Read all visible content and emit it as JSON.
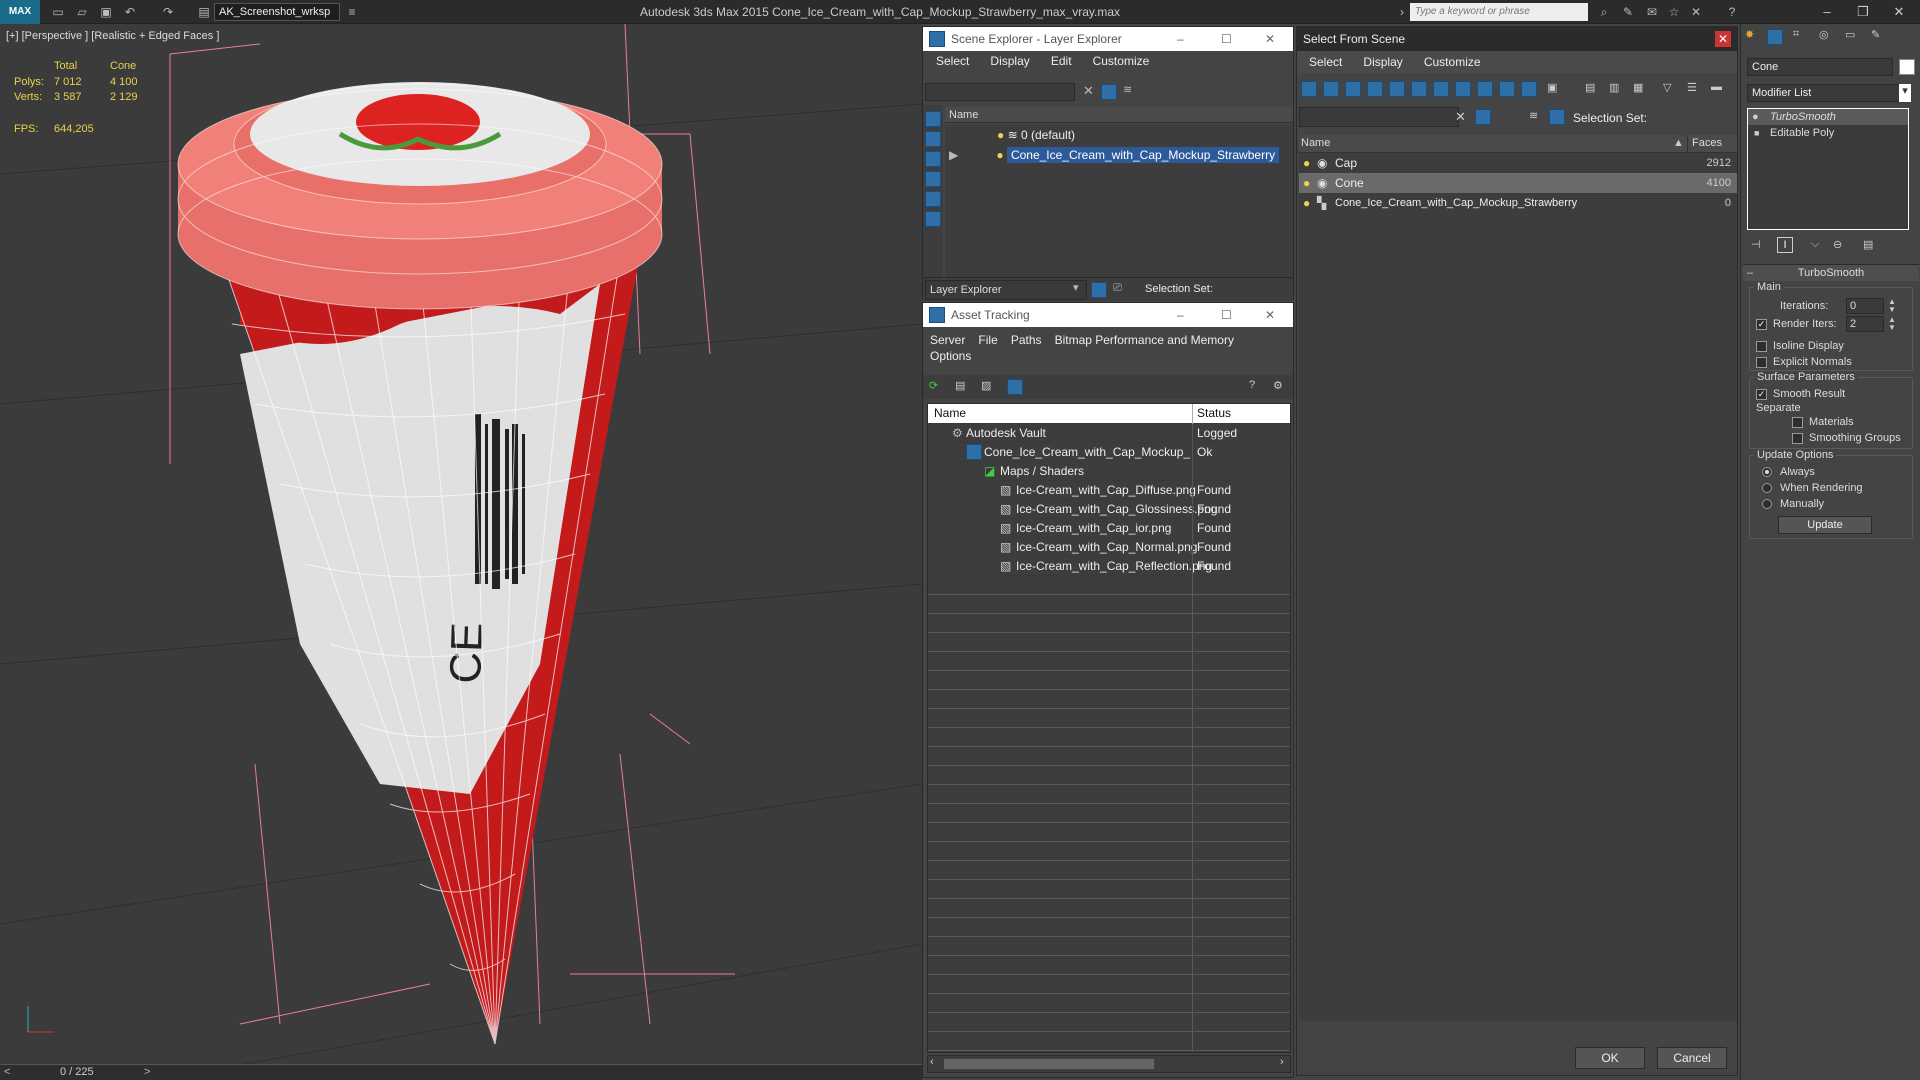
{
  "titlebar": {
    "logo": "MAX",
    "workspace": "AK_Screenshot_wrksp",
    "app_title": "Autodesk 3ds Max  2015     Cone_Ice_Cream_with_Cap_Mockup_Strawberry_max_vray.max",
    "search_placeholder": "Type a keyword or phrase"
  },
  "viewport": {
    "label": "[+] [Perspective ] [Realistic + Edged Faces ]",
    "stats": {
      "col_total": "Total",
      "col_cone": "Cone",
      "polys_label": "Polys:",
      "polys_total": "7 012",
      "polys_cone": "4 100",
      "verts_label": "Verts:",
      "verts_total": "3 587",
      "verts_cone": "2 129",
      "fps_label": "FPS:",
      "fps_value": "644,205"
    },
    "frame_counter": "0 / 225",
    "colors": {
      "cone_red": "#c31a1c",
      "cap_pink": "#e8706a",
      "wrapper_white": "#e0e0e0",
      "wire": "#ffffff"
    }
  },
  "scene_explorer": {
    "title": "Scene Explorer - Layer Explorer",
    "menu": [
      "Select",
      "Display",
      "Edit",
      "Customize"
    ],
    "col_name": "Name",
    "rows": [
      "0 (default)",
      "Cone_Ice_Cream_with_Cap_Mockup_Strawberry"
    ],
    "footer_dropdown": "Layer Explorer",
    "footer_selection_set": "Selection Set:"
  },
  "asset_tracking": {
    "title": "Asset Tracking",
    "menu": [
      "Server",
      "File",
      "Paths",
      "Bitmap Performance and Memory"
    ],
    "menu2": "Options",
    "col_name": "Name",
    "col_status": "Status",
    "rows": [
      {
        "name": "Autodesk Vault",
        "status": "Logged"
      },
      {
        "name": "Cone_Ice_Cream_with_Cap_Mockup_Strawberry...",
        "status": "Ok"
      },
      {
        "name": "Maps / Shaders",
        "status": ""
      },
      {
        "name": "Ice-Cream_with_Cap_Diffuse.png",
        "status": "Found"
      },
      {
        "name": "Ice-Cream_with_Cap_Glossiness.png",
        "status": "Found"
      },
      {
        "name": "Ice-Cream_with_Cap_ior.png",
        "status": "Found"
      },
      {
        "name": "Ice-Cream_with_Cap_Normal.png",
        "status": "Found"
      },
      {
        "name": "Ice-Cream_with_Cap_Reflection.png",
        "status": "Found"
      }
    ]
  },
  "select_from_scene": {
    "title": "Select From Scene",
    "menu": [
      "Select",
      "Display",
      "Customize"
    ],
    "selection_set": "Selection Set:",
    "col_name": "Name",
    "col_faces": "Faces",
    "rows": [
      {
        "name": "Cap",
        "faces": "2912"
      },
      {
        "name": "Cone",
        "faces": "4100"
      },
      {
        "name": "Cone_Ice_Cream_with_Cap_Mockup_Strawberry",
        "faces": "0"
      }
    ],
    "ok": "OK",
    "cancel": "Cancel"
  },
  "modify_panel": {
    "object_name": "Cone",
    "modifier_list": "Modifier List",
    "stack": [
      "TurboSmooth",
      "Editable Poly"
    ],
    "rollout_title": "TurboSmooth",
    "main_label": "Main",
    "iterations_label": "Iterations:",
    "iterations_value": "0",
    "render_iters_label": "Render Iters:",
    "render_iters_value": "2",
    "isoline": "Isoline Display",
    "explicit": "Explicit Normals",
    "surface_params": "Surface Parameters",
    "smooth_result": "Smooth Result",
    "separate": "Separate",
    "materials": "Materials",
    "smoothing_groups": "Smoothing Groups",
    "update_options": "Update Options",
    "always": "Always",
    "when_rendering": "When Rendering",
    "manually": "Manually",
    "update": "Update"
  }
}
